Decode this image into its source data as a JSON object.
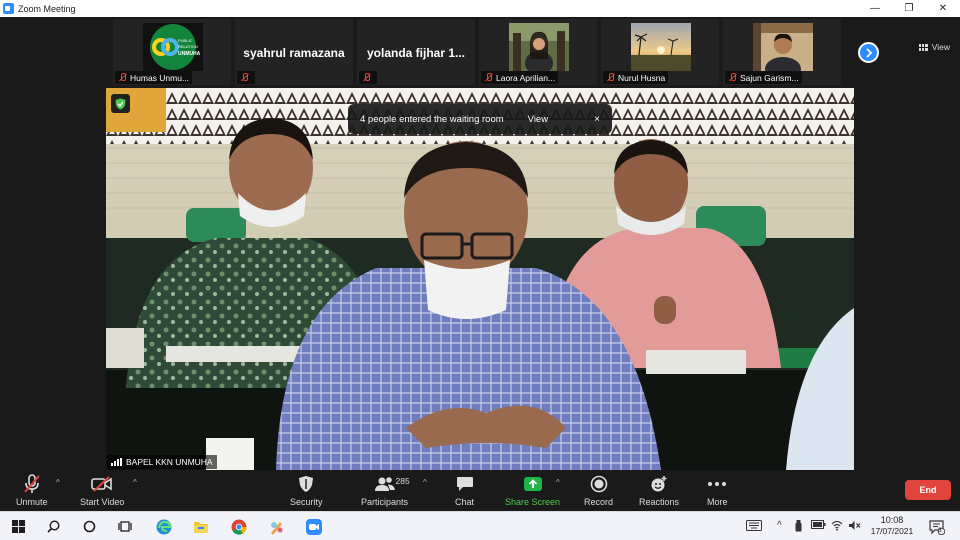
{
  "window": {
    "title": "Zoom Meeting",
    "controls": {
      "minimize": "—",
      "restore": "❐",
      "close": "✕"
    }
  },
  "gallery": {
    "view_label": "View",
    "next_icon": "chevron-right-icon",
    "tiles": [
      {
        "name": "Humas Unmu...",
        "type": "logo",
        "logo_text": [
          "PUBLIC",
          "RELATION",
          "UNMUHA"
        ]
      },
      {
        "name": "syahrul ramazana",
        "type": "name"
      },
      {
        "name": "yolanda fijhar 1...",
        "type": "name"
      },
      {
        "name": "Laora Aprilian...",
        "type": "photo"
      },
      {
        "name": "Nurul Husna",
        "type": "photo"
      },
      {
        "name": "Sajun Garism...",
        "type": "photo"
      }
    ]
  },
  "main": {
    "speaker": "BAPEL KKN UNMUHA",
    "notification": {
      "message": "4 people entered the waiting room",
      "view": "View",
      "close": "×"
    }
  },
  "toolbar": {
    "unmute": "Unmute",
    "start_video": "Start Video",
    "security": "Security",
    "participants": "Participants",
    "participants_count": "285",
    "chat": "Chat",
    "share_screen": "Share Screen",
    "record": "Record",
    "reactions": "Reactions",
    "more": "More",
    "end": "End"
  },
  "taskbar": {
    "time": "10:08",
    "date": "17/07/2021",
    "notifications": "3",
    "colors": {
      "accent": "#2d8cff",
      "danger": "#e0443c",
      "share": "#21b24b"
    }
  }
}
